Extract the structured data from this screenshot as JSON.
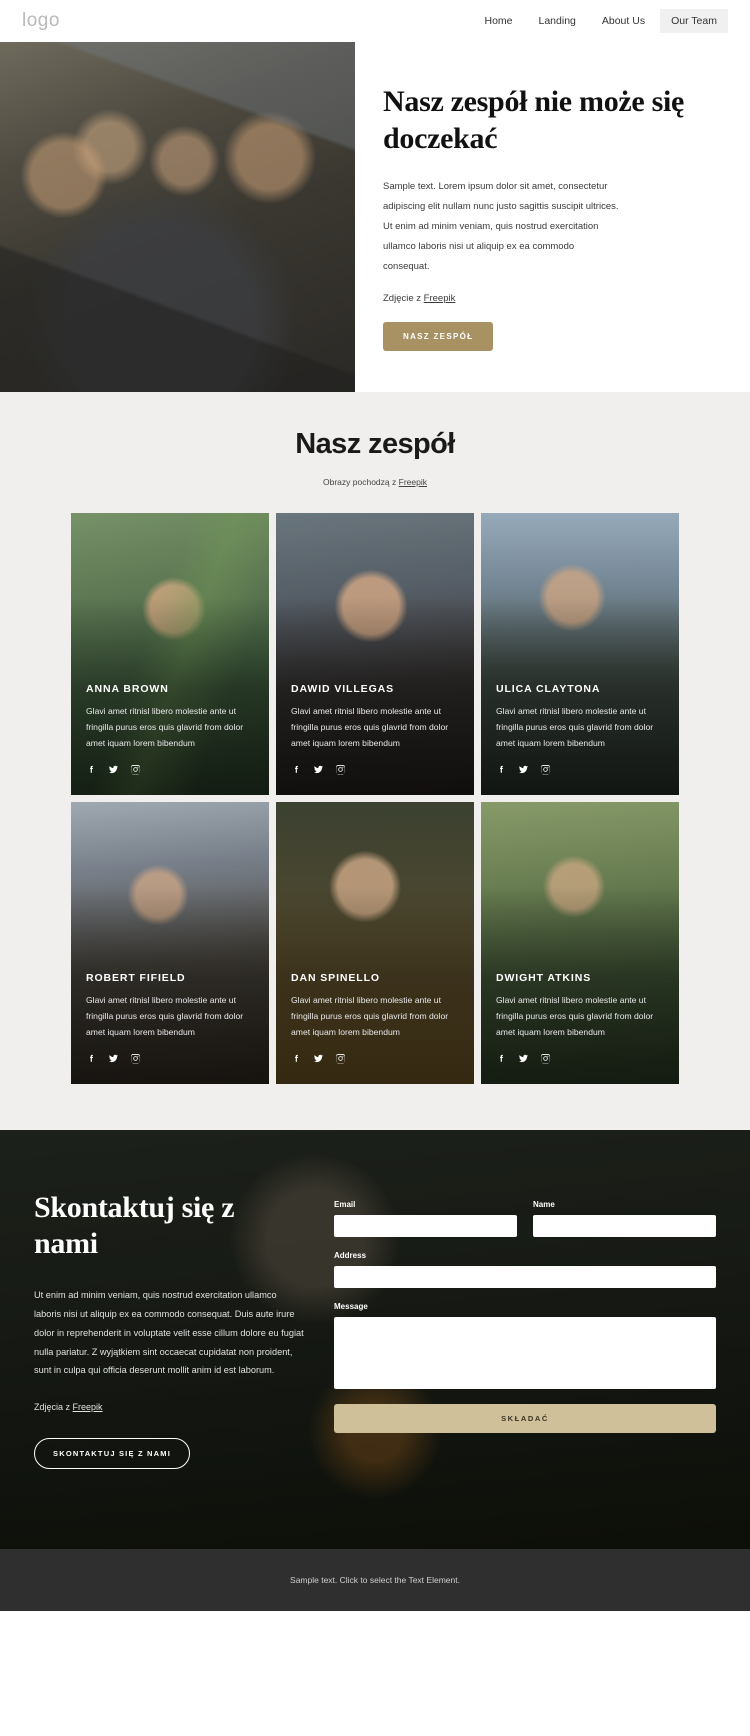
{
  "header": {
    "logo": "logo",
    "nav": [
      {
        "label": "Home",
        "active": false
      },
      {
        "label": "Landing",
        "active": false
      },
      {
        "label": "About Us",
        "active": false
      },
      {
        "label": "Our Team",
        "active": true
      }
    ]
  },
  "hero": {
    "title": "Nasz zespół nie może się doczekać",
    "body": "Sample text. Lorem ipsum dolor sit amet, consectetur adipiscing elit nullam nunc justo sagittis suscipit ultrices. Ut enim ad minim veniam, quis nostrud exercitation ullamco laboris nisi ut aliquip ex ea commodo consequat.",
    "credit_prefix": "Zdjęcie z ",
    "credit_link": "Freepik",
    "button": "NASZ ZESPÓŁ"
  },
  "team": {
    "title": "Nasz zespół",
    "subtitle_prefix": "Obrazy pochodzą z ",
    "subtitle_link": "Freepik",
    "members": [
      {
        "name": "ANNA BROWN",
        "desc": "Glavi amet ritnisl libero molestie ante ut fringilla purus eros quis glavrid from dolor amet iquam lorem bibendum"
      },
      {
        "name": "DAWID VILLEGAS",
        "desc": "Glavi amet ritnisl libero molestie ante ut fringilla purus eros quis glavrid from dolor amet iquam lorem bibendum"
      },
      {
        "name": "ULICA CLAYTONA",
        "desc": "Glavi amet ritnisl libero molestie ante ut fringilla purus eros quis glavrid from dolor amet iquam lorem bibendum"
      },
      {
        "name": "ROBERT FIFIELD",
        "desc": "Glavi amet ritnisl libero molestie ante ut fringilla purus eros quis glavrid from dolor amet iquam lorem bibendum"
      },
      {
        "name": "DAN SPINELLO",
        "desc": "Glavi amet ritnisl libero molestie ante ut fringilla purus eros quis glavrid from dolor amet iquam lorem bibendum"
      },
      {
        "name": "DWIGHT ATKINS",
        "desc": "Glavi amet ritnisl libero molestie ante ut fringilla purus eros quis glavrid from dolor amet iquam lorem bibendum"
      }
    ],
    "social_icons": [
      "facebook-icon",
      "twitter-icon",
      "instagram-icon"
    ]
  },
  "contact": {
    "title": "Skontaktuj się z nami",
    "body": "Ut enim ad minim veniam, quis nostrud exercitation ullamco laboris nisi ut aliquip ex ea commodo consequat. Duis aute irure dolor in reprehenderit in voluptate velit esse cillum dolore eu fugiat nulla pariatur. Z wyjątkiem sint occaecat cupidatat non proident, sunt in culpa qui officia deserunt mollit anim id est laborum.",
    "credit_prefix": "Zdjęcia z ",
    "credit_link": "Freepik",
    "button": "SKONTAKTUJ SIĘ Z NAMI",
    "form": {
      "email_label": "Email",
      "email_value": "",
      "name_label": "Name",
      "name_value": "",
      "address_label": "Address",
      "address_value": "",
      "message_label": "Message",
      "message_value": "",
      "submit_label": "SKŁADAĆ"
    }
  },
  "footer": {
    "text": "Sample text. Click to select the Text Element."
  },
  "colors": {
    "accent_gold": "#a89263",
    "submit_gold": "#cfc09a",
    "team_bg": "#f0efed",
    "footer_bg": "#2f2f2f"
  }
}
